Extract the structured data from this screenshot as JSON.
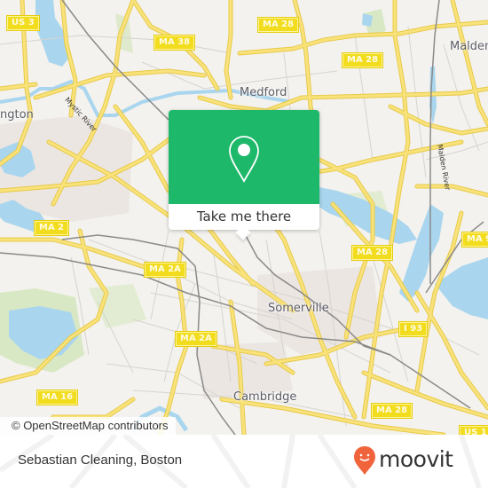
{
  "map": {
    "place_labels": {
      "medford": "Medford",
      "malden": "Malden",
      "arlington": "ngton",
      "somerville": "Somerville",
      "cambridge": "Cambridge"
    },
    "river_labels": {
      "mystic": "Mystic River",
      "malden_river": "Malden River"
    },
    "route_shields": {
      "us3": "US 3",
      "ma38": "MA 38",
      "ma28_a": "MA 28",
      "ma28_b": "MA 28",
      "ma28_c": "MA 28",
      "ma28_d": "MA 28",
      "ma2": "MA 2",
      "ma2a_a": "MA 2A",
      "ma2a_b": "MA 2A",
      "ma16": "MA 16",
      "i93": "I 93",
      "ma99": "MA 9",
      "us1": "US 1"
    },
    "attribution": "© OpenStreetMap contributors",
    "colors": {
      "land": "#f3f2ee",
      "water": "#a9d6ee",
      "road": "#f5de5a",
      "park": "#d9e8c4",
      "accent": "#1eb86a"
    }
  },
  "popup": {
    "icon": "location-pin-icon",
    "button_label": "Take me there"
  },
  "footer": {
    "place_name": "Sebastian Cleaning, Boston",
    "brand": "moovit",
    "brand_color": "#f0643c"
  }
}
